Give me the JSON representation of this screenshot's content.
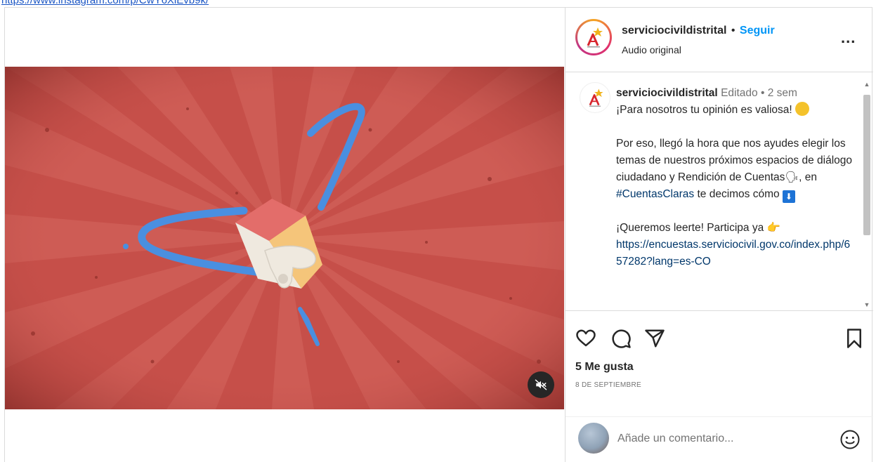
{
  "browser": {
    "url_text": "https://www.instagram.com/p/CwY6XiEvb9k/"
  },
  "post": {
    "header": {
      "username": "serviciocivildistrital",
      "separator": "•",
      "follow_label": "Seguir",
      "audio_label": "Audio original",
      "more_label": "..."
    },
    "caption": {
      "username": "serviciocivildistrital",
      "edited_label": "Editado",
      "separator": "•",
      "time_ago": "2 sem",
      "line1": "¡Para nosotros tu opinión es valiosa!",
      "para2_a": "Por eso, llegó la hora que nos ayudes elegir los temas de nuestros próximos espacios de diálogo ciudadano y Rendición de Cuentas",
      "para2_b": ", en",
      "hashtag": "#CuentasClaras",
      "para2_c": "te decimos cómo",
      "blue_emoji": "⬇",
      "para3": "¡Queremos leerte! Participa ya",
      "link": "https://encuestas.serviciocivil.gov.co/index.php/657282?lang=es-CO"
    },
    "likes_text": "5 Me gusta",
    "date_text": "8 DE SEPTIEMBRE",
    "comment_placeholder": "Añade un comentario..."
  },
  "icons": {
    "like": "heart-icon",
    "comment": "comment-icon",
    "share": "send-icon",
    "save": "bookmark-icon",
    "emoji": "emoji-icon",
    "mute": "speaker-muted-icon",
    "more": "more-options-icon"
  },
  "colors": {
    "media_bg": "#c8524c",
    "follow_blue": "#0095f6",
    "link_blue": "#00376b",
    "url_blue": "#1a55c4"
  }
}
